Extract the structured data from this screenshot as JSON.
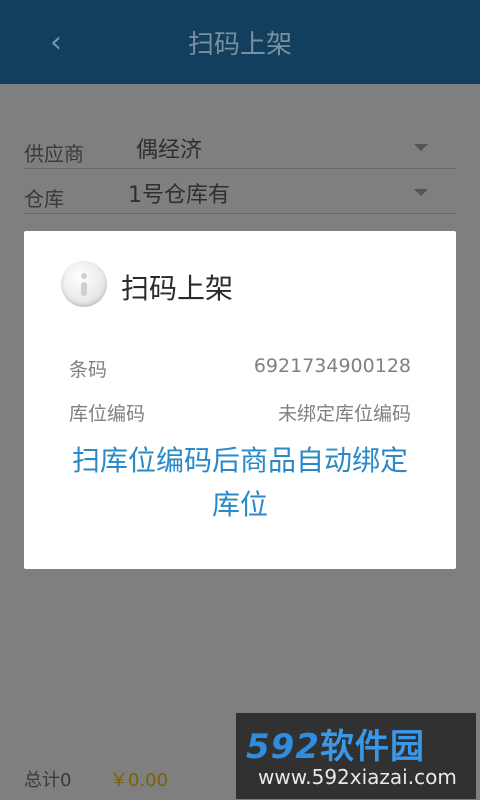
{
  "header": {
    "back_icon": "chevron-left-icon",
    "title": "扫码上架"
  },
  "form": {
    "supplier": {
      "label": "供应商",
      "value": "偶经济"
    },
    "warehouse": {
      "label": "仓库",
      "value": "1号仓库有"
    }
  },
  "footer": {
    "total_label": "总计0",
    "total_amount": "￥0.00"
  },
  "dialog": {
    "icon": "info-icon",
    "title": "扫码上架",
    "rows": [
      {
        "label": "条码",
        "value": "6921734900128"
      },
      {
        "label": "库位编码",
        "value": "未绑定库位编码"
      }
    ],
    "message": "扫库位编码后商品自动绑定库位"
  },
  "watermark": {
    "logo_num": "592",
    "logo_text": "软件园",
    "url": "www.592xiazai.com"
  },
  "colors": {
    "header_bg": "#123f5e",
    "accent": "#2a8ac7",
    "overlay": "#7f7f7f"
  }
}
